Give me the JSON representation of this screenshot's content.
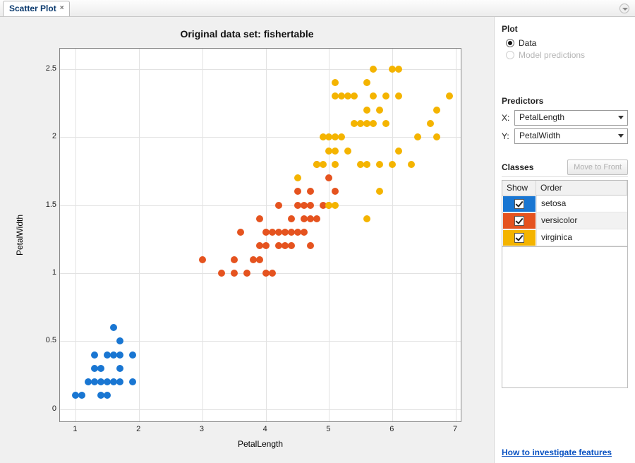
{
  "tab": {
    "label": "Scatter Plot"
  },
  "plot_section": {
    "title": "Plot",
    "radio_data": "Data",
    "radio_model": "Model predictions",
    "selected": "data",
    "model_enabled": false
  },
  "predictors": {
    "title": "Predictors",
    "x_label": "X:",
    "y_label": "Y:",
    "x_value": "PetalLength",
    "y_value": "PetalWidth"
  },
  "classes_panel": {
    "title": "Classes",
    "move_button": "Move to Front",
    "columns": {
      "show": "Show",
      "order": "Order"
    },
    "rows": [
      {
        "name": "setosa",
        "color": "#1976d2",
        "checked": true
      },
      {
        "name": "versicolor",
        "color": "#e5531f",
        "checked": true
      },
      {
        "name": "virginica",
        "color": "#f4b400",
        "checked": true
      }
    ]
  },
  "help_link": "How to investigate features",
  "chart_data": {
    "type": "scatter",
    "title": "Original data set: fishertable",
    "xlabel": "PetalLength",
    "ylabel": "PetalWidth",
    "xlim": [
      0.75,
      7.1
    ],
    "ylim": [
      -0.1,
      2.65
    ],
    "xticks": [
      1,
      2,
      3,
      4,
      5,
      6,
      7
    ],
    "yticks": [
      0,
      0.5,
      1,
      1.5,
      2,
      2.5
    ],
    "series": [
      {
        "name": "setosa",
        "color": "#1976d2",
        "points": [
          [
            1.0,
            0.1
          ],
          [
            1.1,
            0.1
          ],
          [
            1.2,
            0.2
          ],
          [
            1.3,
            0.2
          ],
          [
            1.3,
            0.3
          ],
          [
            1.3,
            0.4
          ],
          [
            1.4,
            0.1
          ],
          [
            1.4,
            0.2
          ],
          [
            1.4,
            0.3
          ],
          [
            1.5,
            0.1
          ],
          [
            1.5,
            0.2
          ],
          [
            1.5,
            0.4
          ],
          [
            1.6,
            0.2
          ],
          [
            1.6,
            0.4
          ],
          [
            1.6,
            0.6
          ],
          [
            1.7,
            0.2
          ],
          [
            1.7,
            0.3
          ],
          [
            1.7,
            0.4
          ],
          [
            1.7,
            0.5
          ],
          [
            1.9,
            0.2
          ],
          [
            1.9,
            0.4
          ]
        ]
      },
      {
        "name": "versicolor",
        "color": "#e5531f",
        "points": [
          [
            3.0,
            1.1
          ],
          [
            3.3,
            1.0
          ],
          [
            3.5,
            1.0
          ],
          [
            3.6,
            1.3
          ],
          [
            3.7,
            1.0
          ],
          [
            3.8,
            1.1
          ],
          [
            3.9,
            1.2
          ],
          [
            3.9,
            1.4
          ],
          [
            4.0,
            1.0
          ],
          [
            4.0,
            1.3
          ],
          [
            4.1,
            1.3
          ],
          [
            4.2,
            1.2
          ],
          [
            4.2,
            1.3
          ],
          [
            4.2,
            1.5
          ],
          [
            4.3,
            1.3
          ],
          [
            4.4,
            1.2
          ],
          [
            4.4,
            1.3
          ],
          [
            4.4,
            1.4
          ],
          [
            4.5,
            1.3
          ],
          [
            4.5,
            1.5
          ],
          [
            4.5,
            1.6
          ],
          [
            4.6,
            1.3
          ],
          [
            4.6,
            1.4
          ],
          [
            4.6,
            1.5
          ],
          [
            4.7,
            1.2
          ],
          [
            4.7,
            1.4
          ],
          [
            4.7,
            1.5
          ],
          [
            4.7,
            1.6
          ],
          [
            4.8,
            1.4
          ],
          [
            4.8,
            1.8
          ],
          [
            4.9,
            1.5
          ],
          [
            5.0,
            1.5
          ],
          [
            5.0,
            1.7
          ],
          [
            5.1,
            1.6
          ],
          [
            3.9,
            1.1
          ],
          [
            4.0,
            1.2
          ],
          [
            4.1,
            1.0
          ],
          [
            4.3,
            1.2
          ],
          [
            3.5,
            1.1
          ]
        ]
      },
      {
        "name": "virginica",
        "color": "#f4b400",
        "points": [
          [
            4.5,
            1.7
          ],
          [
            4.8,
            1.8
          ],
          [
            4.9,
            1.8
          ],
          [
            4.9,
            2.0
          ],
          [
            5.0,
            1.5
          ],
          [
            5.0,
            1.9
          ],
          [
            5.0,
            2.0
          ],
          [
            5.1,
            1.5
          ],
          [
            5.1,
            1.8
          ],
          [
            5.1,
            1.9
          ],
          [
            5.1,
            2.0
          ],
          [
            5.1,
            2.3
          ],
          [
            5.1,
            2.4
          ],
          [
            5.2,
            2.0
          ],
          [
            5.2,
            2.3
          ],
          [
            5.3,
            1.9
          ],
          [
            5.3,
            2.3
          ],
          [
            5.4,
            2.1
          ],
          [
            5.4,
            2.3
          ],
          [
            5.5,
            1.8
          ],
          [
            5.5,
            2.1
          ],
          [
            5.6,
            1.4
          ],
          [
            5.6,
            1.8
          ],
          [
            5.6,
            2.1
          ],
          [
            5.6,
            2.2
          ],
          [
            5.6,
            2.4
          ],
          [
            5.7,
            2.1
          ],
          [
            5.7,
            2.3
          ],
          [
            5.7,
            2.5
          ],
          [
            5.8,
            1.6
          ],
          [
            5.8,
            1.8
          ],
          [
            5.8,
            2.2
          ],
          [
            5.9,
            2.1
          ],
          [
            5.9,
            2.3
          ],
          [
            6.0,
            1.8
          ],
          [
            6.0,
            2.5
          ],
          [
            6.1,
            1.9
          ],
          [
            6.1,
            2.3
          ],
          [
            6.1,
            2.5
          ],
          [
            6.3,
            1.8
          ],
          [
            6.4,
            2.0
          ],
          [
            6.6,
            2.1
          ],
          [
            6.7,
            2.0
          ],
          [
            6.7,
            2.2
          ],
          [
            6.9,
            2.3
          ]
        ]
      }
    ]
  }
}
